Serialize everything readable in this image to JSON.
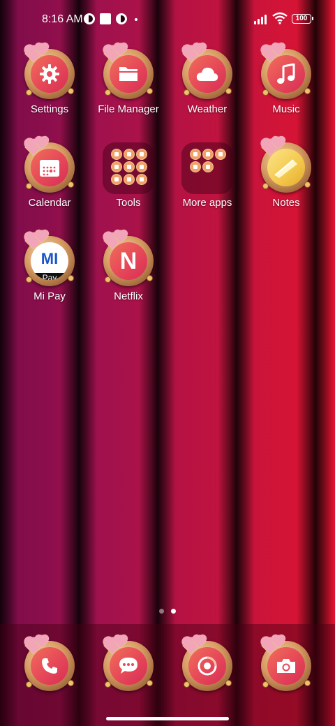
{
  "status_bar": {
    "time": "8:16 AM",
    "battery": "100",
    "icons": [
      "notification-app-icon",
      "notification-square-icon",
      "notification-app-icon",
      "dot-icon",
      "signal-icon",
      "wifi-icon",
      "battery-icon"
    ]
  },
  "home": {
    "apps": [
      {
        "label": "Settings",
        "icon": "gear-icon"
      },
      {
        "label": "File Manager",
        "icon": "folder-icon"
      },
      {
        "label": "Weather",
        "icon": "cloud-icon"
      },
      {
        "label": "Music",
        "icon": "music-note-icon"
      },
      {
        "label": "Calendar",
        "icon": "calendar-icon"
      },
      {
        "label": "Tools",
        "icon": "folder-group-icon"
      },
      {
        "label": "More apps",
        "icon": "folder-group-icon"
      },
      {
        "label": "Notes",
        "icon": "notes-icon"
      },
      {
        "label": "Mi Pay",
        "icon": "mi-pay-logo",
        "logo_text": "MI",
        "logo_sub": "Pay"
      },
      {
        "label": "Netflix",
        "icon": "netflix-icon",
        "logo_text": "N"
      }
    ]
  },
  "page_indicator": {
    "pages": 2,
    "current": 2
  },
  "dock": {
    "apps": [
      {
        "label": "Phone",
        "icon": "phone-icon"
      },
      {
        "label": "Messages",
        "icon": "message-bubble-icon"
      },
      {
        "label": "Browser",
        "icon": "browser-icon"
      },
      {
        "label": "Camera",
        "icon": "camera-icon"
      }
    ]
  },
  "colors": {
    "wallpaper_left": "#7a0c4a",
    "wallpaper_right": "#e01430",
    "icon_inner": "#e74a58",
    "icon_ring": "#d69a62",
    "mipay_blue": "#1a56c8"
  }
}
